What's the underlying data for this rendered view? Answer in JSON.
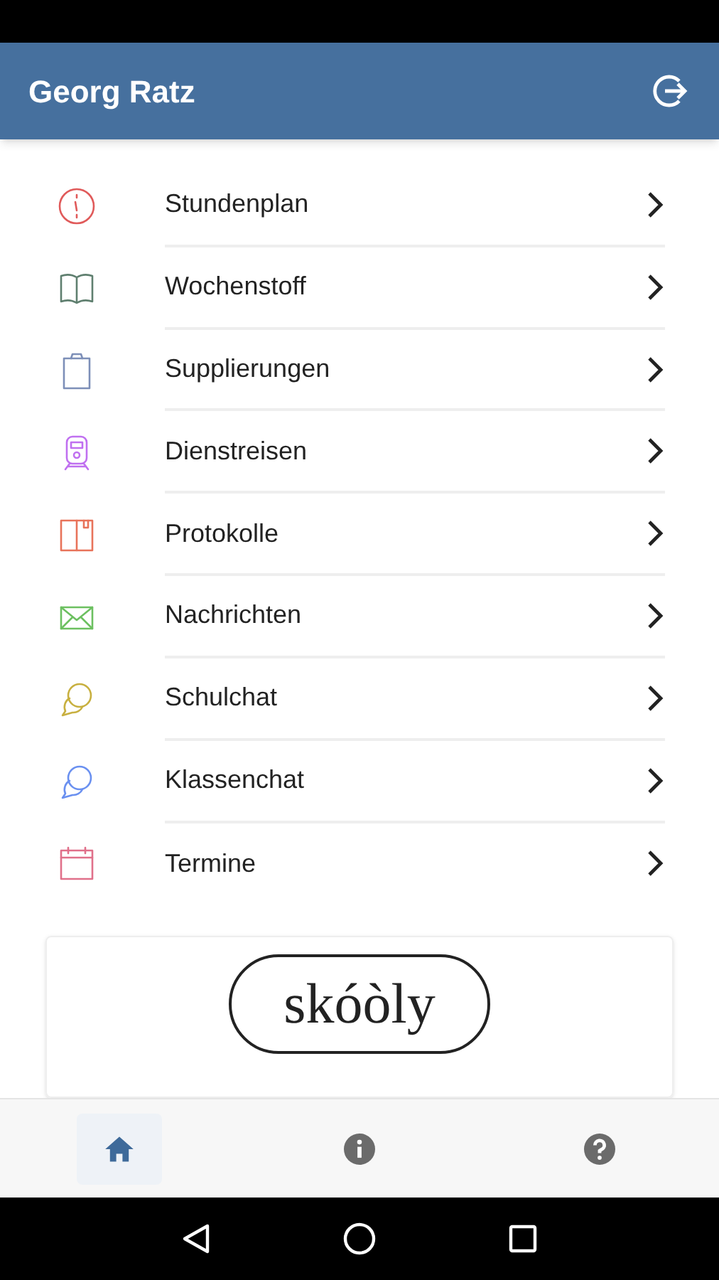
{
  "header": {
    "title": "Georg Ratz"
  },
  "menu": [
    {
      "label": "Stundenplan",
      "color": "#e05a5a"
    },
    {
      "label": "Wochenstoff",
      "color": "#5f7f6f"
    },
    {
      "label": "Supplierungen",
      "color": "#7d8fb8"
    },
    {
      "label": "Dienstreisen",
      "color": "#c070f0"
    },
    {
      "label": "Protokolle",
      "color": "#e8735a"
    },
    {
      "label": "Nachrichten",
      "color": "#6cc060"
    },
    {
      "label": "Schulchat",
      "color": "#c8b040"
    },
    {
      "label": "Klassenchat",
      "color": "#6a90f0"
    },
    {
      "label": "Termine",
      "color": "#e0708a"
    }
  ],
  "logo": {
    "text": "skóòly"
  },
  "bottom_nav": [
    {
      "selected": true
    },
    {
      "selected": false
    },
    {
      "selected": false
    }
  ]
}
